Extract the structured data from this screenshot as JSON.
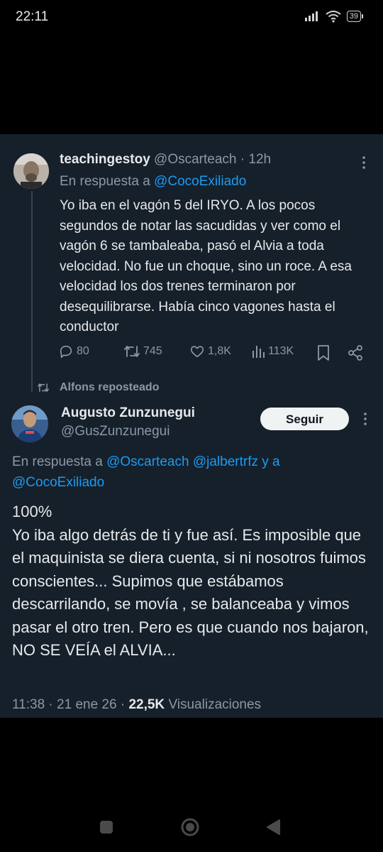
{
  "status_bar": {
    "time": "22:11",
    "battery": "39"
  },
  "tweet1": {
    "display_name": "teachingestoy",
    "handle": "@Oscarteach",
    "separator": "·",
    "time_ago": "12h",
    "reply_prefix": "En respuesta a",
    "reply_to": "@CocoExiliado",
    "text": "Yo iba en el vagón 5 del IRYO. A los pocos segundos de notar las sacudidas y ver como el vagón 6 se tambaleaba, pasó el Alvia a toda velocidad. No fue un choque, sino un roce. A esa velocidad los dos trenes terminaron por desequilibrarse. Había cinco vagones hasta el conductor",
    "replies": "80",
    "reposts": "745",
    "likes": "1,8K",
    "views": "113K"
  },
  "repost_banner": {
    "text": "Alfons reposteado"
  },
  "tweet2": {
    "display_name": "Augusto Zunzunegui",
    "handle": "@GusZunzunegui",
    "follow_label": "Seguir",
    "reply_prefix": "En respuesta a",
    "reply_to_1": "@Oscarteach",
    "reply_to_2": "@jalbertrfz",
    "reply_joiner": "y a",
    "reply_to_3": "@CocoExiliado",
    "text": "100%\nYo iba algo detrás de ti y fue así. Es imposible que el maquinista se diera cuenta, si ni nosotros fuimos conscientes... Supimos que estábamos descarrilando, se movía , se balanceaba y vimos pasar el otro tren. Pero es que cuando nos bajaron, NO SE VEÍA el ALVIA...",
    "time": "11:38",
    "date": "21 ene 26",
    "dot": "·",
    "views_count": "22,5K",
    "views_label": "Visualizaciones"
  },
  "colors": {
    "panel_bg": "#15202b",
    "text_primary": "#e7e9ea",
    "text_muted": "#8b98a5",
    "link": "#1d9bf0",
    "follow_bg": "#eff3f4"
  },
  "icons": [
    "signal-icon",
    "wifi-icon",
    "battery-icon",
    "more-icon",
    "reply-icon",
    "repost-icon",
    "like-icon",
    "views-icon",
    "bookmark-icon",
    "share-icon",
    "nav-recents-icon",
    "nav-home-icon",
    "nav-back-icon"
  ]
}
